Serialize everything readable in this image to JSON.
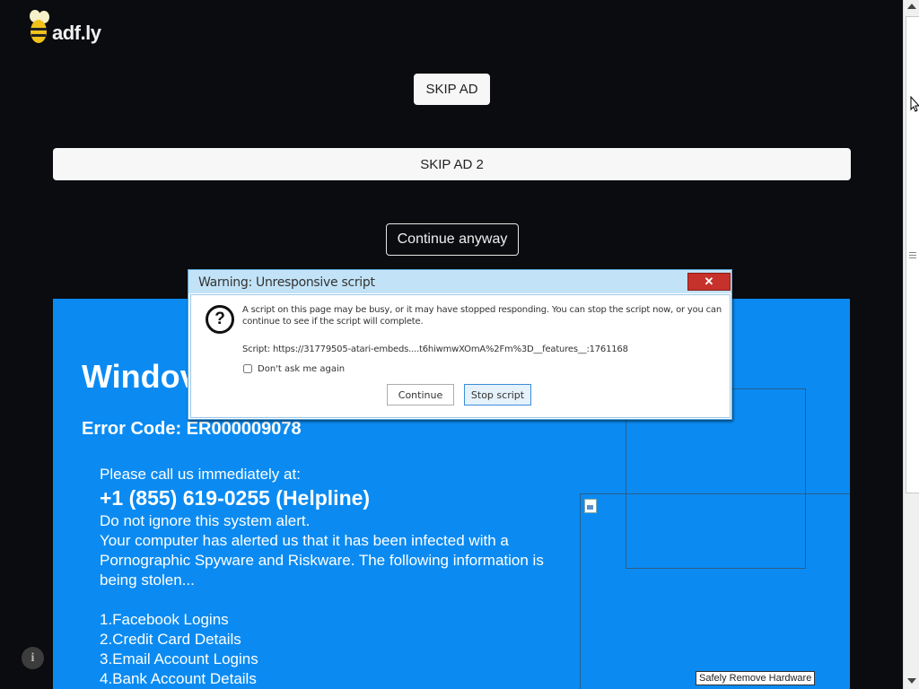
{
  "header": {
    "logo_text": "adf.ly"
  },
  "ad_buttons": {
    "skip_ad": "SKIP AD",
    "skip_ad_2": "SKIP AD 2",
    "continue_anyway": "Continue anyway"
  },
  "scam_panel": {
    "background_color": "#0b8bf2",
    "title": "Windov",
    "error_code": "Error Code: ER000009078",
    "call_line": "Please call us immediately at:",
    "phone": "+1 (855) 619-0255 (Helpline)",
    "warning_lines": [
      "Do not ignore this system alert.",
      "Your computer has alerted us that it has been infected with a Pornographic Spyware and Riskware. The following information is being stolen..."
    ],
    "stolen_items": [
      "1.Facebook Logins",
      "2.Credit Card Details",
      "3.Email Account Logins",
      "4.Bank Account Details"
    ],
    "tooltip": "Safely Remove Hardware"
  },
  "dialog": {
    "title": "Warning: Unresponsive script",
    "message": "A script on this page may be busy, or it may have stopped responding. You can stop the script now, or you can continue to see if the script will complete.",
    "script": "Script: https://31779505-atari-embeds....t6hiwmwXOmA%2Fm%3D__features__:1761168",
    "checkbox_label": "Don't ask me again",
    "checkbox_checked": false,
    "continue_label": "Continue",
    "stop_label": "Stop script",
    "close_label": "✕"
  },
  "icons": {
    "logo": "bee-icon",
    "info": "info-icon",
    "dialog": "question-icon"
  }
}
